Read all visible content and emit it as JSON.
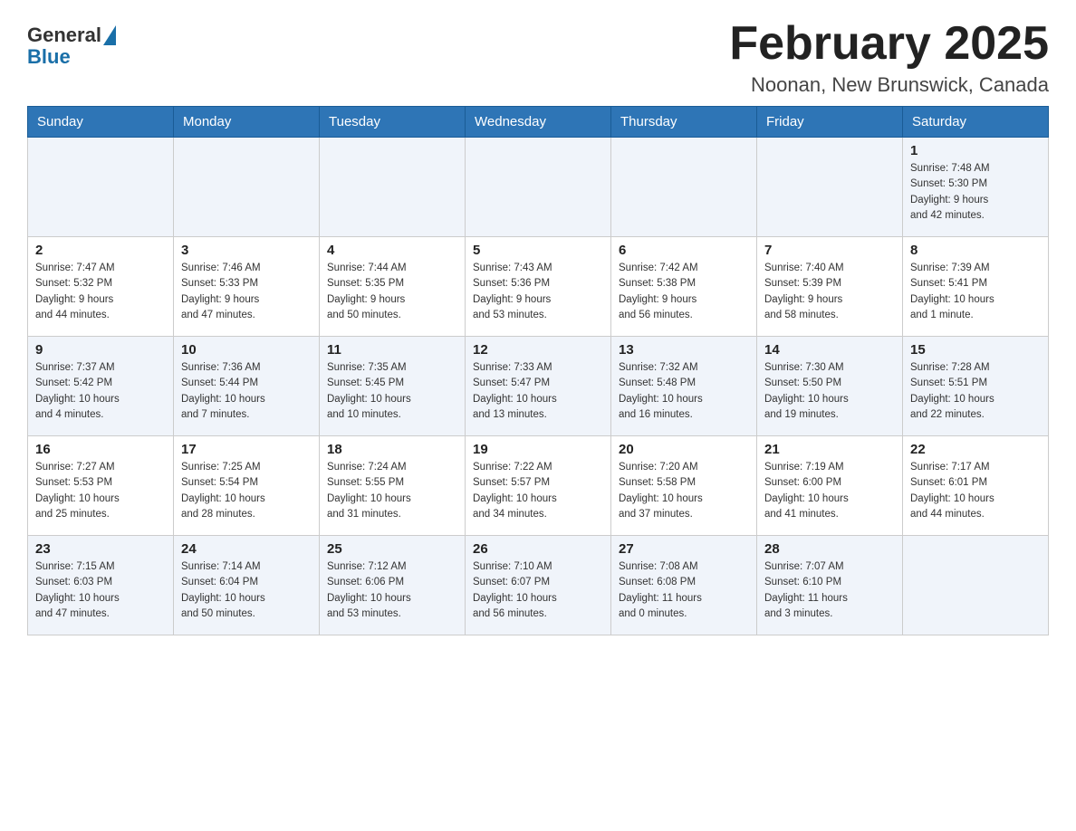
{
  "header": {
    "title": "February 2025",
    "subtitle": "Noonan, New Brunswick, Canada",
    "logo_general": "General",
    "logo_blue": "Blue"
  },
  "days_of_week": [
    "Sunday",
    "Monday",
    "Tuesday",
    "Wednesday",
    "Thursday",
    "Friday",
    "Saturday"
  ],
  "weeks": [
    [
      {
        "day": "",
        "info": ""
      },
      {
        "day": "",
        "info": ""
      },
      {
        "day": "",
        "info": ""
      },
      {
        "day": "",
        "info": ""
      },
      {
        "day": "",
        "info": ""
      },
      {
        "day": "",
        "info": ""
      },
      {
        "day": "1",
        "info": "Sunrise: 7:48 AM\nSunset: 5:30 PM\nDaylight: 9 hours\nand 42 minutes."
      }
    ],
    [
      {
        "day": "2",
        "info": "Sunrise: 7:47 AM\nSunset: 5:32 PM\nDaylight: 9 hours\nand 44 minutes."
      },
      {
        "day": "3",
        "info": "Sunrise: 7:46 AM\nSunset: 5:33 PM\nDaylight: 9 hours\nand 47 minutes."
      },
      {
        "day": "4",
        "info": "Sunrise: 7:44 AM\nSunset: 5:35 PM\nDaylight: 9 hours\nand 50 minutes."
      },
      {
        "day": "5",
        "info": "Sunrise: 7:43 AM\nSunset: 5:36 PM\nDaylight: 9 hours\nand 53 minutes."
      },
      {
        "day": "6",
        "info": "Sunrise: 7:42 AM\nSunset: 5:38 PM\nDaylight: 9 hours\nand 56 minutes."
      },
      {
        "day": "7",
        "info": "Sunrise: 7:40 AM\nSunset: 5:39 PM\nDaylight: 9 hours\nand 58 minutes."
      },
      {
        "day": "8",
        "info": "Sunrise: 7:39 AM\nSunset: 5:41 PM\nDaylight: 10 hours\nand 1 minute."
      }
    ],
    [
      {
        "day": "9",
        "info": "Sunrise: 7:37 AM\nSunset: 5:42 PM\nDaylight: 10 hours\nand 4 minutes."
      },
      {
        "day": "10",
        "info": "Sunrise: 7:36 AM\nSunset: 5:44 PM\nDaylight: 10 hours\nand 7 minutes."
      },
      {
        "day": "11",
        "info": "Sunrise: 7:35 AM\nSunset: 5:45 PM\nDaylight: 10 hours\nand 10 minutes."
      },
      {
        "day": "12",
        "info": "Sunrise: 7:33 AM\nSunset: 5:47 PM\nDaylight: 10 hours\nand 13 minutes."
      },
      {
        "day": "13",
        "info": "Sunrise: 7:32 AM\nSunset: 5:48 PM\nDaylight: 10 hours\nand 16 minutes."
      },
      {
        "day": "14",
        "info": "Sunrise: 7:30 AM\nSunset: 5:50 PM\nDaylight: 10 hours\nand 19 minutes."
      },
      {
        "day": "15",
        "info": "Sunrise: 7:28 AM\nSunset: 5:51 PM\nDaylight: 10 hours\nand 22 minutes."
      }
    ],
    [
      {
        "day": "16",
        "info": "Sunrise: 7:27 AM\nSunset: 5:53 PM\nDaylight: 10 hours\nand 25 minutes."
      },
      {
        "day": "17",
        "info": "Sunrise: 7:25 AM\nSunset: 5:54 PM\nDaylight: 10 hours\nand 28 minutes."
      },
      {
        "day": "18",
        "info": "Sunrise: 7:24 AM\nSunset: 5:55 PM\nDaylight: 10 hours\nand 31 minutes."
      },
      {
        "day": "19",
        "info": "Sunrise: 7:22 AM\nSunset: 5:57 PM\nDaylight: 10 hours\nand 34 minutes."
      },
      {
        "day": "20",
        "info": "Sunrise: 7:20 AM\nSunset: 5:58 PM\nDaylight: 10 hours\nand 37 minutes."
      },
      {
        "day": "21",
        "info": "Sunrise: 7:19 AM\nSunset: 6:00 PM\nDaylight: 10 hours\nand 41 minutes."
      },
      {
        "day": "22",
        "info": "Sunrise: 7:17 AM\nSunset: 6:01 PM\nDaylight: 10 hours\nand 44 minutes."
      }
    ],
    [
      {
        "day": "23",
        "info": "Sunrise: 7:15 AM\nSunset: 6:03 PM\nDaylight: 10 hours\nand 47 minutes."
      },
      {
        "day": "24",
        "info": "Sunrise: 7:14 AM\nSunset: 6:04 PM\nDaylight: 10 hours\nand 50 minutes."
      },
      {
        "day": "25",
        "info": "Sunrise: 7:12 AM\nSunset: 6:06 PM\nDaylight: 10 hours\nand 53 minutes."
      },
      {
        "day": "26",
        "info": "Sunrise: 7:10 AM\nSunset: 6:07 PM\nDaylight: 10 hours\nand 56 minutes."
      },
      {
        "day": "27",
        "info": "Sunrise: 7:08 AM\nSunset: 6:08 PM\nDaylight: 11 hours\nand 0 minutes."
      },
      {
        "day": "28",
        "info": "Sunrise: 7:07 AM\nSunset: 6:10 PM\nDaylight: 11 hours\nand 3 minutes."
      },
      {
        "day": "",
        "info": ""
      }
    ]
  ]
}
